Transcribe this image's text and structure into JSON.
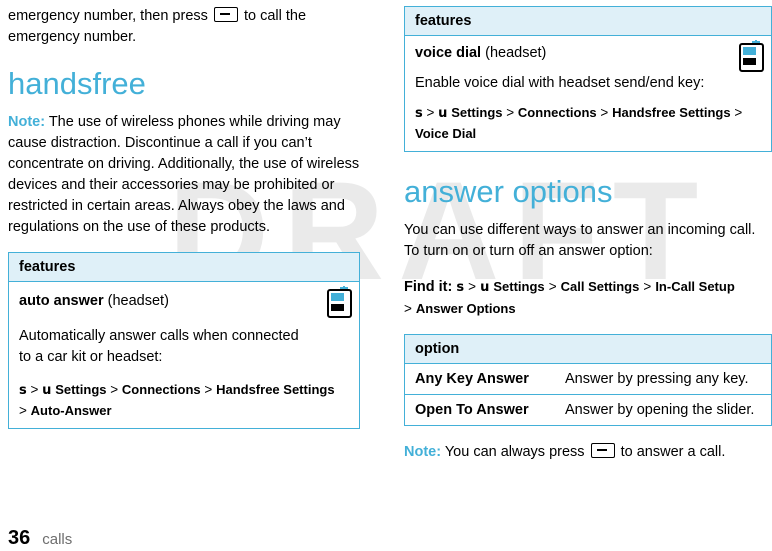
{
  "watermark": "DRAFT",
  "left": {
    "intro": {
      "line1": "emergency number, then press",
      "line2": "to call the",
      "line3": "emergency number."
    },
    "heading": "handsfree",
    "note": {
      "label": "Note:",
      "text": " The use of wireless phones while driving may cause distraction. Discontinue a call if you can’t concentrate on driving. Additionally, the use of wireless devices and their accessories may be prohibited or restricted in certain areas. Always obey the laws and regulations on the use of these products."
    },
    "table": {
      "header": "features",
      "feature_name": "auto answer",
      "feature_qualifier": "(headset)",
      "description_line1": "Automatically answer calls when connected",
      "description_line2": "to a car kit or headset:",
      "path": [
        "s",
        ">",
        "u",
        "Settings",
        ">",
        "Connections",
        ">",
        "Handsfree Settings",
        ">",
        "Auto-Answer"
      ]
    }
  },
  "right": {
    "table1": {
      "header": "features",
      "feature_name": "voice dial",
      "feature_qualifier": "(headset)",
      "description": "Enable voice dial with headset send/end key:",
      "path": [
        "s",
        ">",
        "u",
        "Settings",
        ">",
        "Connections",
        ">",
        "Handsfree Settings",
        ">",
        "Voice Dial"
      ]
    },
    "heading": "answer options",
    "body1": "You can use different ways to answer an incoming call. To turn on or turn off an answer option:",
    "finditem": {
      "label": "Find it:",
      "path": [
        "s",
        ">",
        "u",
        "Settings",
        ">",
        "Call Settings",
        ">",
        "In-Call Setup",
        ">",
        "Answer Options"
      ]
    },
    "table2": {
      "header": "option",
      "rows": [
        {
          "name": "Any Key Answer",
          "desc": "Answer by pressing any key."
        },
        {
          "name": "Open To Answer",
          "desc": "Answer by opening the slider."
        }
      ]
    },
    "note": {
      "label": "Note:",
      "text_before": " You can always press",
      "text_after": "to answer a call."
    }
  },
  "footer": {
    "page": "36",
    "section": "calls"
  },
  "icons": {
    "phone": "phone-icon",
    "send_key": "send-key-icon",
    "navigation_key": "navigation-key-icon",
    "settings_gear": "settings-gear-icon"
  },
  "colors": {
    "accent": "#43b0d8",
    "table_header_bg": "#dff0f8",
    "watermark": "#d9d9d9"
  }
}
